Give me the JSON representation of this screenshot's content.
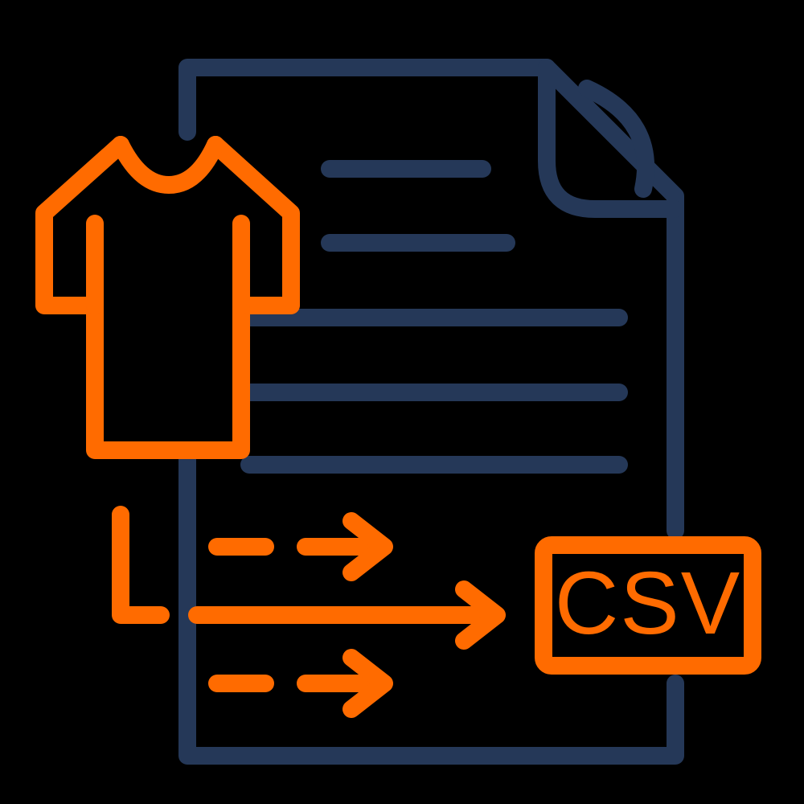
{
  "colors": {
    "navy": "#253858",
    "orange": "#ff6b00",
    "background": "#000000"
  },
  "badge": {
    "label": "CSV"
  }
}
